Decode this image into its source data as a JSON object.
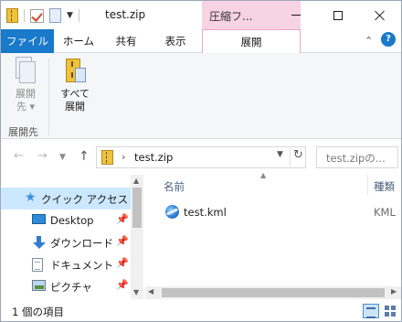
{
  "title_bar": {
    "window_title": "test.zip",
    "contextual_tab_title": "圧縮フ..."
  },
  "ribbon_tabs": {
    "file": "ファイル",
    "home": "ホーム",
    "share": "共有",
    "view": "表示",
    "extract": "展開"
  },
  "ribbon": {
    "extract_to_label_1": "展開",
    "extract_to_label_2": "先 ▾",
    "extract_all_label_1": "すべて",
    "extract_all_label_2": "展開",
    "group_label": "展開先"
  },
  "address": {
    "path": "test.zip",
    "search_placeholder": "test.zipの..."
  },
  "nav_pane": {
    "quick_access": "クイック アクセス",
    "items": [
      {
        "label": "Desktop",
        "icon": "desktop-icon"
      },
      {
        "label": "ダウンロード",
        "icon": "download-icon"
      },
      {
        "label": "ドキュメント",
        "icon": "document-icon"
      },
      {
        "label": "ピクチャ",
        "icon": "pictures-icon"
      }
    ]
  },
  "content": {
    "columns": {
      "name": "名前",
      "type": "種類"
    },
    "files": [
      {
        "name": "test.kml",
        "type": "KML",
        "icon": "kml-file-icon"
      }
    ]
  },
  "status": {
    "item_count": "1 個の項目"
  },
  "colors": {
    "file_tab": "#1979ca",
    "contextual_tab": "#f7d3e4",
    "selection": "#cce8ff"
  }
}
